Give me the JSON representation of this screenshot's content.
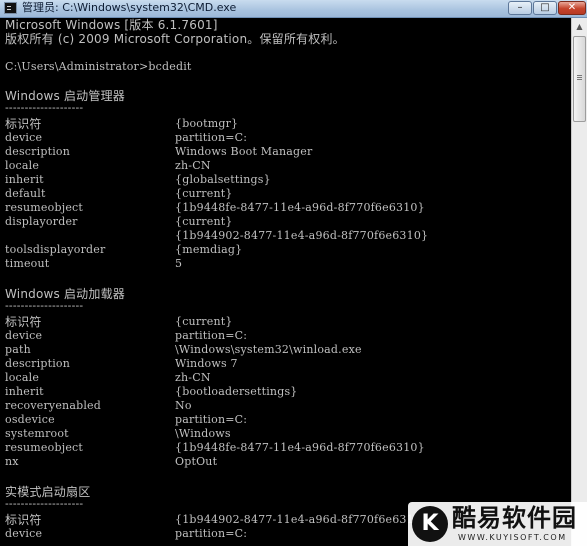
{
  "window": {
    "title": "管理员: C:\\Windows\\system32\\CMD.exe",
    "minimize_label": "–",
    "maximize_label": "□",
    "close_label": "✕"
  },
  "console": {
    "header": [
      "Microsoft Windows [版本 6.1.7601]",
      "版权所有 (c) 2009 Microsoft Corporation。保留所有权利。"
    ],
    "prompt": "C:\\Users\\Administrator>bcdedit",
    "sections": [
      {
        "title": "Windows 启动管理器",
        "underline": "--------------------",
        "entries": [
          {
            "key": "标识符",
            "value": "{bootmgr}"
          },
          {
            "key": "device",
            "value": "partition=C:"
          },
          {
            "key": "description",
            "value": "Windows Boot Manager"
          },
          {
            "key": "locale",
            "value": "zh-CN"
          },
          {
            "key": "inherit",
            "value": "{globalsettings}"
          },
          {
            "key": "default",
            "value": "{current}"
          },
          {
            "key": "resumeobject",
            "value": "{1b9448fe-8477-11e4-a96d-8f770f6e6310}"
          },
          {
            "key": "displayorder",
            "value": "{current}"
          },
          {
            "key": "",
            "value": "{1b944902-8477-11e4-a96d-8f770f6e6310}"
          },
          {
            "key": "toolsdisplayorder",
            "value": "{memdiag}"
          },
          {
            "key": "timeout",
            "value": "5"
          }
        ]
      },
      {
        "title": "Windows 启动加载器",
        "underline": "--------------------",
        "entries": [
          {
            "key": "标识符",
            "value": "{current}"
          },
          {
            "key": "device",
            "value": "partition=C:"
          },
          {
            "key": "path",
            "value": "\\Windows\\system32\\winload.exe"
          },
          {
            "key": "description",
            "value": "Windows 7"
          },
          {
            "key": "locale",
            "value": "zh-CN"
          },
          {
            "key": "inherit",
            "value": "{bootloadersettings}"
          },
          {
            "key": "recoveryenabled",
            "value": "No"
          },
          {
            "key": "osdevice",
            "value": "partition=C:"
          },
          {
            "key": "systemroot",
            "value": "\\Windows"
          },
          {
            "key": "resumeobject",
            "value": "{1b9448fe-8477-11e4-a96d-8f770f6e6310}"
          },
          {
            "key": "nx",
            "value": "OptOut"
          }
        ]
      },
      {
        "title": "实模式启动扇区",
        "underline": "--------------------",
        "entries": [
          {
            "key": "标识符",
            "value": "{1b944902-8477-11e4-a96d-8f770f6e6310}"
          },
          {
            "key": "device",
            "value": "partition=C:"
          }
        ]
      }
    ]
  },
  "scrollbar": {
    "up_arrow": "▲"
  },
  "watermark": {
    "logo_letter": "K",
    "name": "酷易软件园",
    "url": "WWW.KUYISOFT.COM"
  },
  "colors": {
    "console_bg": "#000000",
    "console_text": "#c0c0c0",
    "titlebar": "#a9c3df",
    "close_button": "#c5432c"
  }
}
